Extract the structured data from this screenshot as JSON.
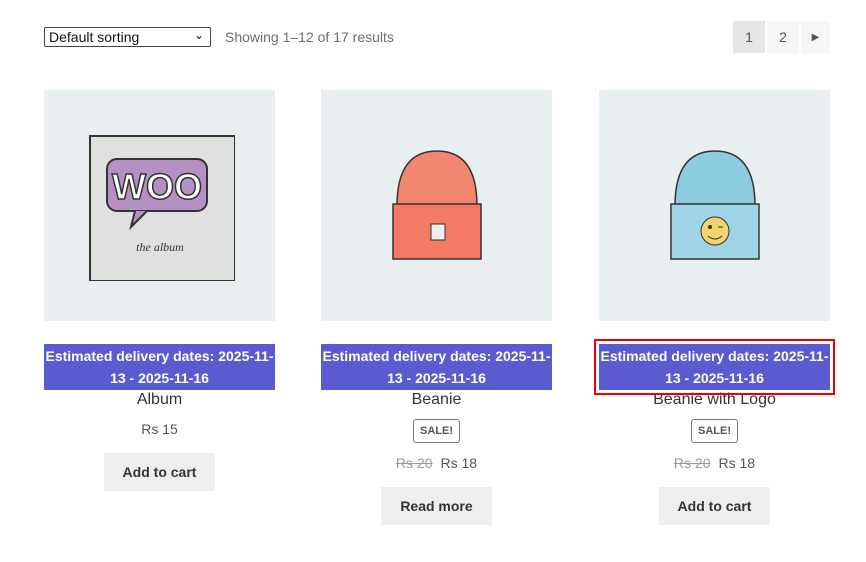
{
  "toolbar": {
    "sort": "Default sorting",
    "result_count": "Showing 1–12 of 17 results"
  },
  "pagination": {
    "pages": [
      "1",
      "2"
    ],
    "current": "1",
    "next_icon": "chevron-right-icon"
  },
  "products": [
    {
      "name": "Album",
      "delivery": "Estimated delivery dates: 2025-11-13 - 2025-11-16",
      "price": "Rs 15",
      "button": "Add to cart"
    },
    {
      "name": "Beanie",
      "delivery": "Estimated delivery dates: 2025-11-13 - 2025-11-16",
      "badge": "SALE!",
      "old_price": "Rs 20",
      "price": "Rs 18",
      "button": "Read more"
    },
    {
      "name": "Beanie with Logo",
      "delivery": "Estimated delivery dates: 2025-11-13 - 2025-11-16",
      "badge": "SALE!",
      "old_price": "Rs 20",
      "price": "Rs 18",
      "button": "Add to cart"
    }
  ],
  "album_art": {
    "logo": "WOO",
    "caption": "the album"
  },
  "colors": {
    "banner": "#5a5bd0",
    "highlight": "#e00000"
  }
}
